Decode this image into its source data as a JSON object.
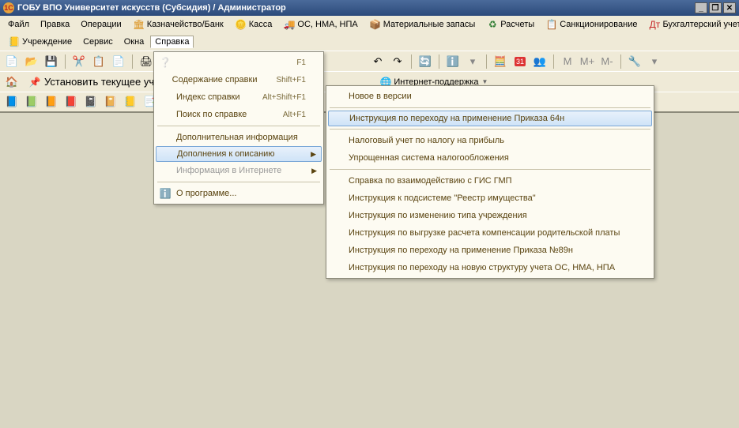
{
  "titlebar": {
    "icon": "1C",
    "title": "ГОБУ ВПО Университет искусств (Субсидия) / Администратор"
  },
  "menubar": {
    "file": "Файл",
    "edit": "Правка",
    "operations": "Операции",
    "treasury": "Казначейство/Банк",
    "cash": "Касса",
    "assets": "ОС, НМА, НПА",
    "materials": "Материальные запасы",
    "calc": "Расчеты",
    "sanction": "Санкционирование",
    "accounting": "Бухгалтерский учет"
  },
  "menubar2": {
    "institution": "Учреждение",
    "service": "Сервис",
    "windows": "Окна",
    "help": "Справка"
  },
  "toolbar2_text": {
    "set_current": "Установить текущее учреждени"
  },
  "internet": {
    "support": "Интернет-поддержка"
  },
  "help_menu": {
    "contents": {
      "label": "Содержание справки",
      "shortcut": "Shift+F1"
    },
    "index": {
      "label": "Индекс справки",
      "shortcut": "Alt+Shift+F1"
    },
    "search": {
      "label": "Поиск по справке",
      "shortcut": "Alt+F1"
    },
    "f1": {
      "shortcut": "F1"
    },
    "extra": {
      "label": "Дополнительная информация"
    },
    "additions": {
      "label": "Дополнения к описанию"
    },
    "inet": {
      "label": "Информация в Интернете"
    },
    "about": {
      "label": "О программе..."
    }
  },
  "additions_menu": {
    "new": "Новое в версии",
    "order64": "Инструкция по переходу на применение Приказа 64н",
    "tax": "Налоговый учет по налогу на прибыль",
    "simple": "Упрощенная система налогообложения",
    "gis": "Справка по взаимодействию с ГИС ГМП",
    "registry": "Инструкция к подсистеме \"Реестр имущества\"",
    "typechange": "Инструкция по изменению типа учреждения",
    "parentpay": "Инструкция по выгрузке расчета компенсации родительской платы",
    "order89": "Инструкция по переходу на применение Приказа №89н",
    "osstruct": "Инструкция по переходу на новую структуру учета ОС, НМА, НПА"
  },
  "tool_gray": {
    "m": "M",
    "mp": "M+",
    "mm": "M-"
  }
}
